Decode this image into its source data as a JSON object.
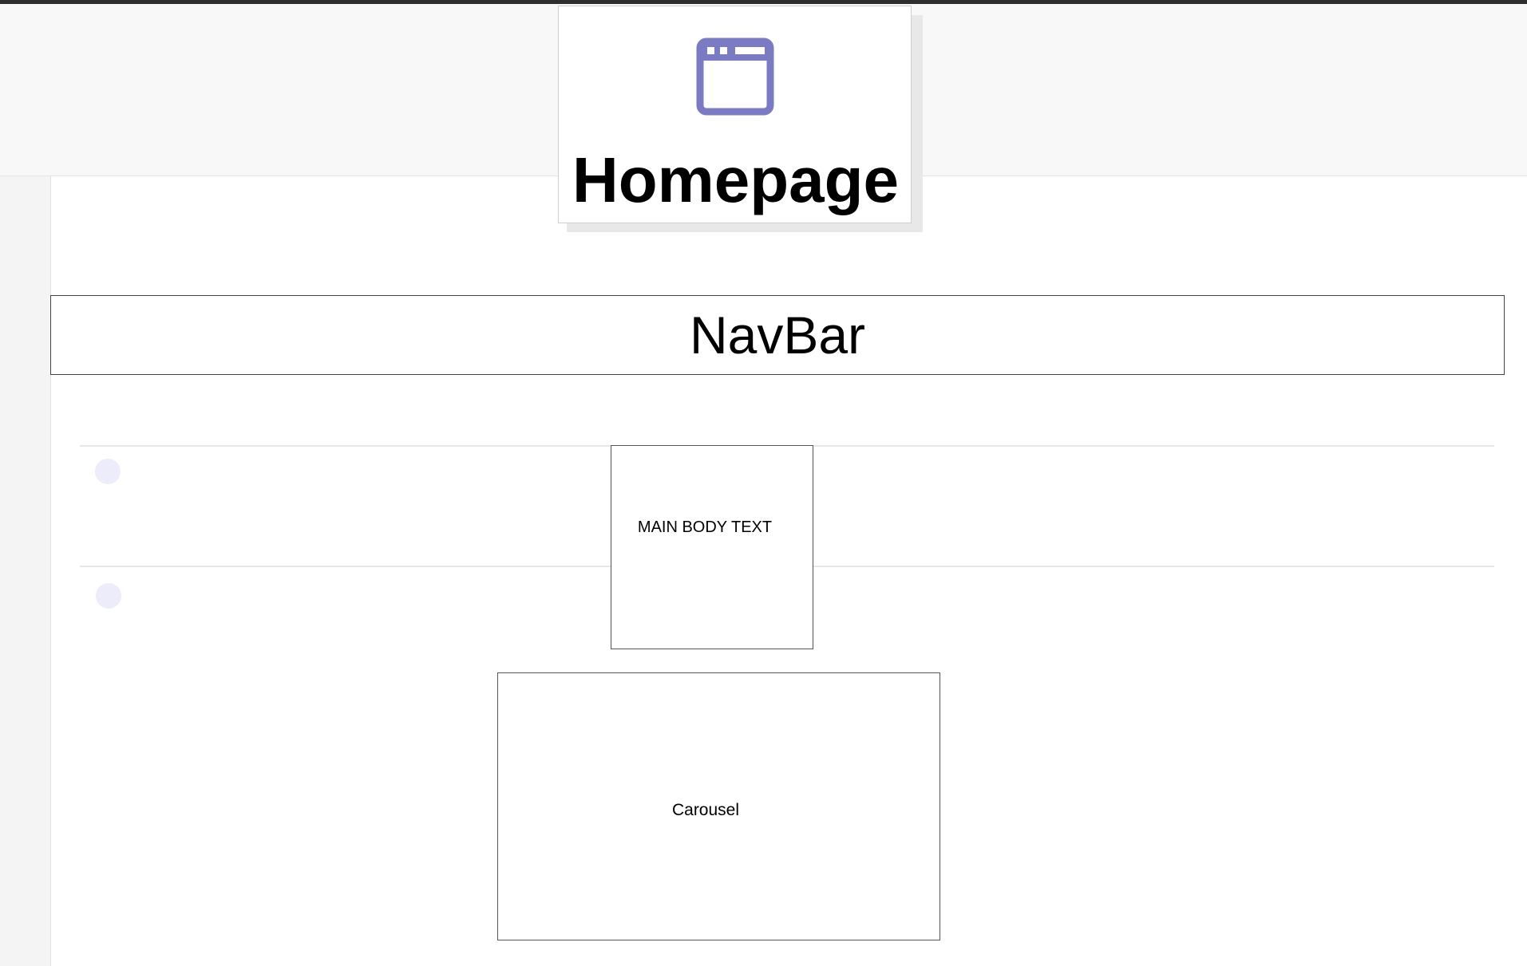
{
  "page_card": {
    "title": "Homepage",
    "icon": "browser-window-icon",
    "icon_color": "#7b7bc4"
  },
  "navbar": {
    "label": "NavBar"
  },
  "main_body": {
    "label": "MAIN BODY TEXT"
  },
  "carousel": {
    "label": "Carousel"
  }
}
